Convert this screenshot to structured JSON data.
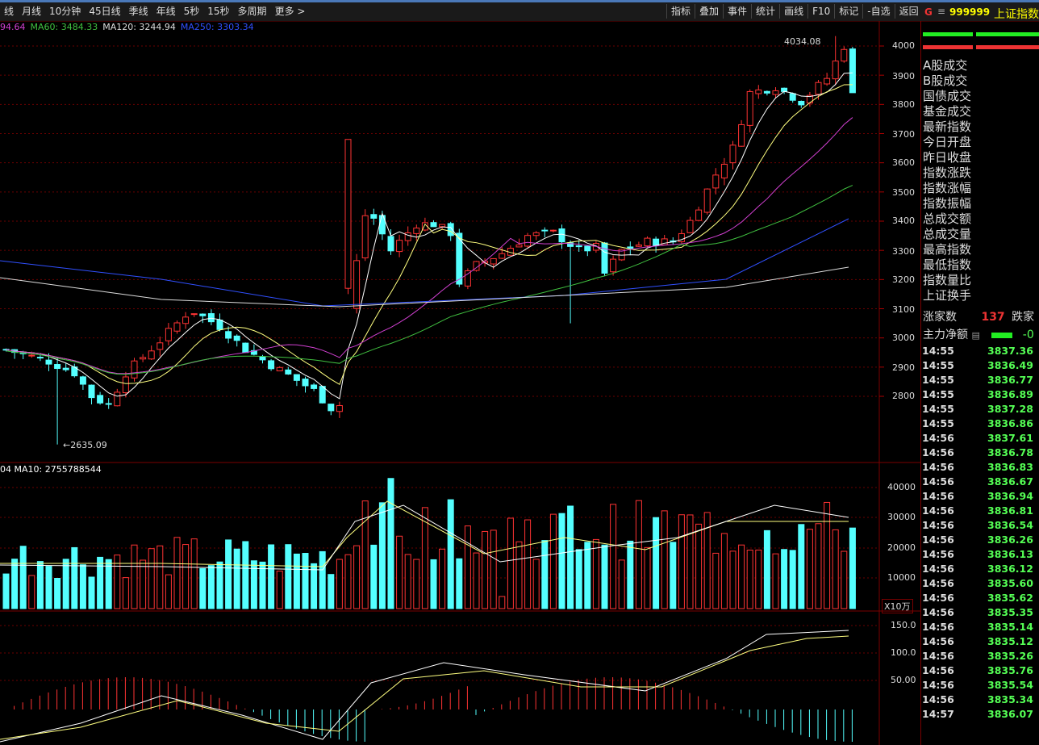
{
  "toolbar": {
    "periods": [
      "线",
      "月线",
      "10分钟",
      "45日线",
      "季线",
      "年线",
      "5秒",
      "15秒",
      "多周期",
      "更多 >"
    ],
    "tools": [
      "指标",
      "叠加",
      "事件",
      "统计",
      "画线",
      "F10",
      "标记",
      "-自选",
      "返回"
    ]
  },
  "title": {
    "g": "G",
    "menu": "≡",
    "code": "999999",
    "name": "上证指数"
  },
  "ma_legend": [
    {
      "label": "94.64",
      "color": "#d040d0"
    },
    {
      "label": "MA60: 3484.33",
      "color": "#40c040"
    },
    {
      "label": "MA120: 3244.94",
      "color": "#dddddd"
    },
    {
      "label": "MA250: 3303.34",
      "color": "#3050ff"
    }
  ],
  "vol_legend": "04  MA10: 2755788544",
  "price_axis": [
    "4000",
    "3900",
    "3800",
    "3700",
    "3600",
    "3500",
    "3400",
    "3300",
    "3200",
    "3100",
    "3000",
    "2900",
    "2800"
  ],
  "vol_axis": [
    "40000",
    "30000",
    "20000",
    "10000"
  ],
  "vol_unit": "X10万",
  "macd_axis": [
    "150.0",
    "100.0",
    "50.00"
  ],
  "annotations": {
    "high": "4034.08",
    "low": "2635.09"
  },
  "side": {
    "labels": [
      "A股成交",
      "B股成交",
      "国债成交",
      "基金成交",
      "最新指数",
      "今日开盘",
      "昨日收盘",
      "指数涨跌",
      "指数涨幅",
      "指数振幅",
      "总成交额",
      "总成交量",
      "最高指数",
      "最低指数",
      "指数量比",
      "上证换手"
    ],
    "up_label": "涨家数",
    "up_value": "137",
    "down_label": "跌家",
    "flow_label": "主力净额",
    "flow_value": "-0"
  },
  "ticks": [
    {
      "t": "14:55",
      "p": "3837.36"
    },
    {
      "t": "14:55",
      "p": "3836.49"
    },
    {
      "t": "14:55",
      "p": "3836.77"
    },
    {
      "t": "14:55",
      "p": "3836.89"
    },
    {
      "t": "14:55",
      "p": "3837.28"
    },
    {
      "t": "14:55",
      "p": "3836.86"
    },
    {
      "t": "14:56",
      "p": "3837.61"
    },
    {
      "t": "14:56",
      "p": "3836.78"
    },
    {
      "t": "14:56",
      "p": "3836.83"
    },
    {
      "t": "14:56",
      "p": "3836.67"
    },
    {
      "t": "14:56",
      "p": "3836.94"
    },
    {
      "t": "14:56",
      "p": "3836.81"
    },
    {
      "t": "14:56",
      "p": "3836.54"
    },
    {
      "t": "14:56",
      "p": "3836.26"
    },
    {
      "t": "14:56",
      "p": "3836.13"
    },
    {
      "t": "14:56",
      "p": "3836.12"
    },
    {
      "t": "14:56",
      "p": "3835.60"
    },
    {
      "t": "14:56",
      "p": "3835.62"
    },
    {
      "t": "14:56",
      "p": "3835.35"
    },
    {
      "t": "14:56",
      "p": "3835.14"
    },
    {
      "t": "14:56",
      "p": "3835.12"
    },
    {
      "t": "14:56",
      "p": "3835.26"
    },
    {
      "t": "14:56",
      "p": "3835.76"
    },
    {
      "t": "14:56",
      "p": "3835.54"
    },
    {
      "t": "14:56",
      "p": "3835.34"
    },
    {
      "t": "14:57",
      "p": "3836.07"
    }
  ]
}
